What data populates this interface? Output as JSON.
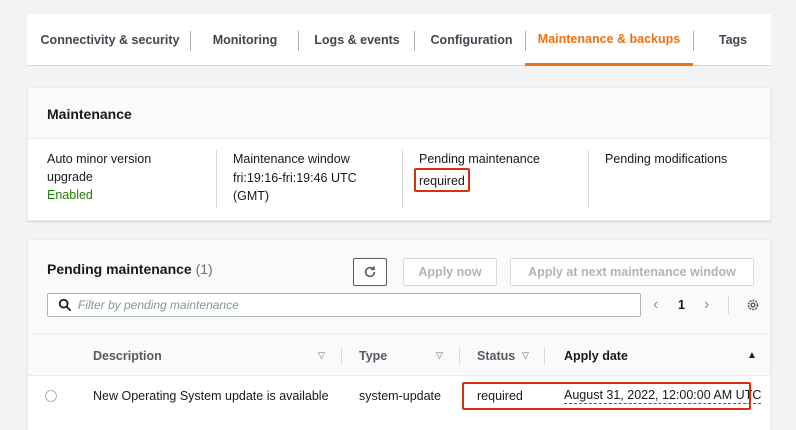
{
  "tabs": [
    {
      "label": "Connectivity & security"
    },
    {
      "label": "Monitoring"
    },
    {
      "label": "Logs & events"
    },
    {
      "label": "Configuration"
    },
    {
      "label": "Maintenance & backups",
      "active": true
    },
    {
      "label": "Tags"
    }
  ],
  "maintenance": {
    "title": "Maintenance",
    "auto_minor": {
      "label_line1": "Auto minor version",
      "label_line2": "upgrade",
      "value": "Enabled"
    },
    "window": {
      "label": "Maintenance window",
      "value_line1": "fri:19:16-fri:19:46 UTC",
      "value_line2": "(GMT)"
    },
    "pending": {
      "label": "Pending maintenance",
      "value": "required"
    },
    "modifications": {
      "label": "Pending modifications"
    }
  },
  "pending_table": {
    "title": "Pending maintenance",
    "count": "(1)",
    "buttons": {
      "apply_now": "Apply now",
      "apply_next": "Apply at next maintenance window"
    },
    "filter_placeholder": "Filter by pending maintenance",
    "page": "1",
    "columns": {
      "description": "Description",
      "type": "Type",
      "status": "Status",
      "apply_date": "Apply date"
    },
    "rows": [
      {
        "description": "New Operating System update is available",
        "type": "system-update",
        "status": "required",
        "apply_date": "August 31, 2022, 12:00:00 AM UTC"
      }
    ]
  },
  "colors": {
    "accent": "#ec7211",
    "enabled": "#1d8102",
    "highlight_box": "#d13212"
  }
}
